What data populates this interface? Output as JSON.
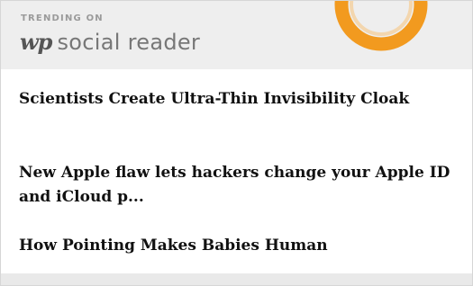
{
  "header": {
    "eyebrow": "TRENDING ON",
    "logo_mark": "wp",
    "brand": "social reader",
    "ring_icon": "social-reader-ring-icon",
    "accent_color": "#f29a1f"
  },
  "headlines": [
    {
      "title": "Scientists Create Ultra-Thin Invisibility Cloak"
    },
    {
      "title": "New Apple flaw lets hackers change your Apple ID and iCloud p..."
    },
    {
      "title": "How Pointing Makes Babies Human"
    }
  ]
}
